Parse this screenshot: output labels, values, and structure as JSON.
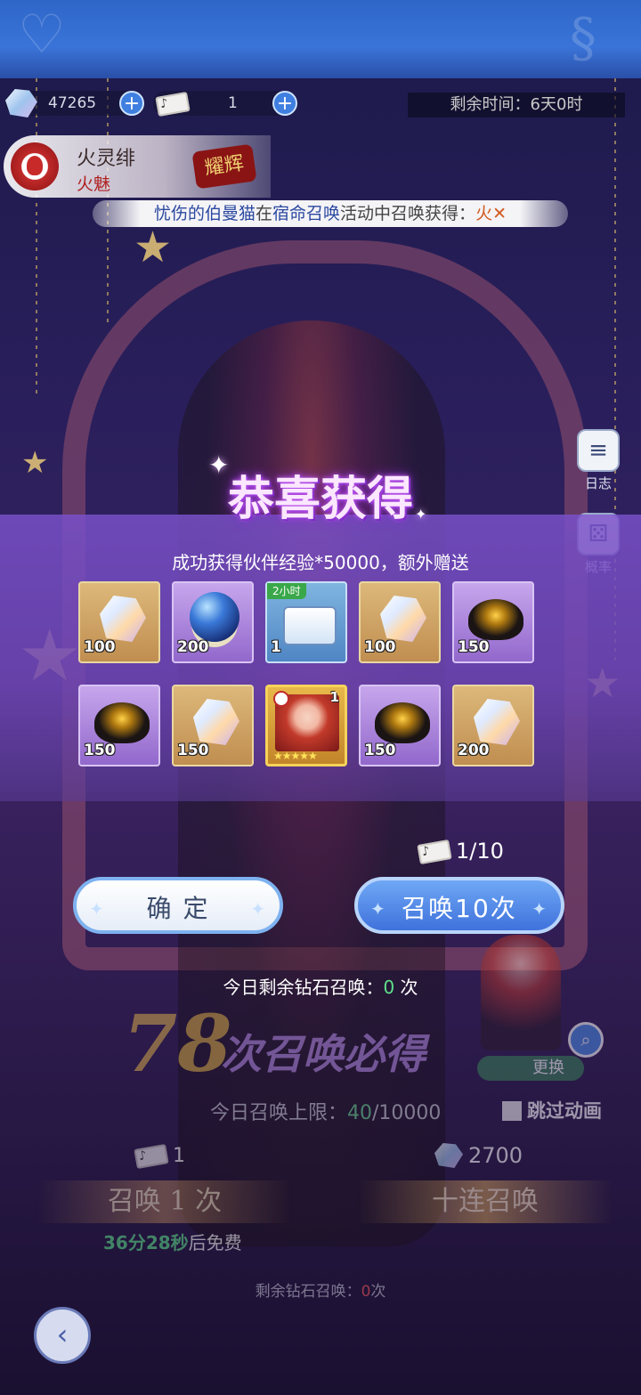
{
  "currency": {
    "crystals": "47265",
    "tickets": "1",
    "countdown": "剩余时间：6天0时"
  },
  "character": {
    "name": "火灵绯",
    "title": "火魅",
    "rank": "耀辉"
  },
  "broadcast": {
    "player": "忧伤的伯曼猫",
    "in_text": "在",
    "event": "宿命召唤",
    "tail": "活动中召唤获得：",
    "reward": "火"
  },
  "side_buttons": {
    "log_label": "日志",
    "rate_label": "概率"
  },
  "reward_panel": {
    "title": "恭喜获得",
    "subtitle": "成功获得伙伴经验*50000，额外赠送",
    "items": [
      {
        "type": "crystal",
        "qty": "100",
        "bg": "gold"
      },
      {
        "type": "orb",
        "qty": "200",
        "bg": "purple"
      },
      {
        "type": "chest",
        "qty": "1",
        "bg": "blue",
        "badge": "2小时"
      },
      {
        "type": "crystal",
        "qty": "100",
        "bg": "gold"
      },
      {
        "type": "ore",
        "qty": "150",
        "bg": "purple"
      },
      {
        "type": "ore",
        "qty": "150",
        "bg": "purple"
      },
      {
        "type": "crystal",
        "qty": "150",
        "bg": "gold"
      },
      {
        "type": "hero",
        "qty": "1",
        "bg": "hero",
        "stars": "★★★★★"
      },
      {
        "type": "ore",
        "qty": "150",
        "bg": "purple"
      },
      {
        "type": "crystal",
        "qty": "200",
        "bg": "gold"
      }
    ],
    "ticket_progress": "1/10",
    "confirm_label": "确 定",
    "summon10_label": "召唤10次",
    "remaining_label": "今日剩余钻石召唤：",
    "remaining_value": "0",
    "remaining_unit": "次"
  },
  "background_ui": {
    "pity_number": "78",
    "pity_text": "次召唤必得",
    "switch_label": "更换",
    "daily_limit_label": "今日召唤上限：",
    "daily_limit_used": "40",
    "daily_limit_total": "/10000",
    "skip_label": "跳过动画",
    "single_cost": "1",
    "ten_cost": "2700",
    "summon1_label": "召唤 1 次",
    "summon10_label": "十连召唤",
    "free_time": "36分28秒",
    "free_suffix": "后免费",
    "remain_label": "剩余钻石召唤：",
    "remain_value": "0",
    "remain_unit": "次"
  }
}
